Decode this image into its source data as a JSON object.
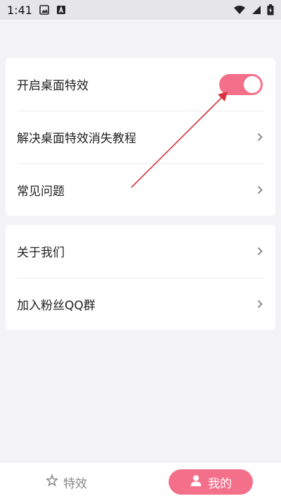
{
  "status_bar": {
    "time": "1:41",
    "icons": [
      "image-icon",
      "text-a-icon",
      "wifi-icon",
      "signal-icon",
      "battery-charging-icon"
    ]
  },
  "settings": {
    "group1": [
      {
        "label": "开启桌面特效",
        "control": "toggle",
        "enabled": true
      },
      {
        "label": "解决桌面特效消失教程",
        "control": "chevron"
      },
      {
        "label": "常见问题",
        "control": "chevron"
      }
    ],
    "group2": [
      {
        "label": "关于我们",
        "control": "chevron"
      },
      {
        "label": "加入粉丝QQ群",
        "control": "chevron"
      }
    ]
  },
  "nav": {
    "effects_label": "特效",
    "mine_label": "我的",
    "active": "mine"
  },
  "colors": {
    "accent": "#f4708a",
    "annotation_arrow": "#d8323c",
    "background": "#f3f3f5"
  }
}
